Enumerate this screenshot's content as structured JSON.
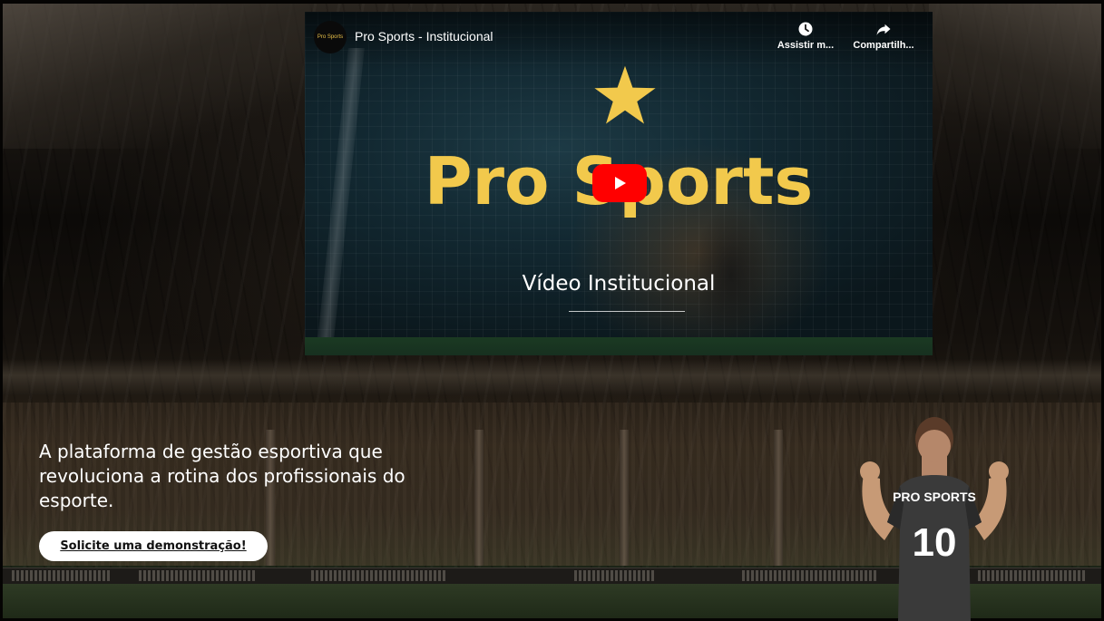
{
  "video": {
    "channel_avatar_text": "Pro Sports",
    "title": "Pro Sports - Institucional",
    "actions": [
      {
        "label": "Assistir m...",
        "icon": "clock-icon"
      },
      {
        "label": "Compartilh...",
        "icon": "share-icon"
      }
    ],
    "brand_text": "Pro Sports",
    "subtitle": "Vídeo Institucional",
    "play_button_color": "#ff0000",
    "brand_color": "#f2c94c"
  },
  "hero": {
    "tagline": "A plataforma de gestão esportiva que revoluciona a rotina dos profissionais do esporte.",
    "cta_label": "Solicite uma demonstração!"
  },
  "player": {
    "jersey_text": "PRO SPORTS",
    "jersey_number": "10"
  }
}
